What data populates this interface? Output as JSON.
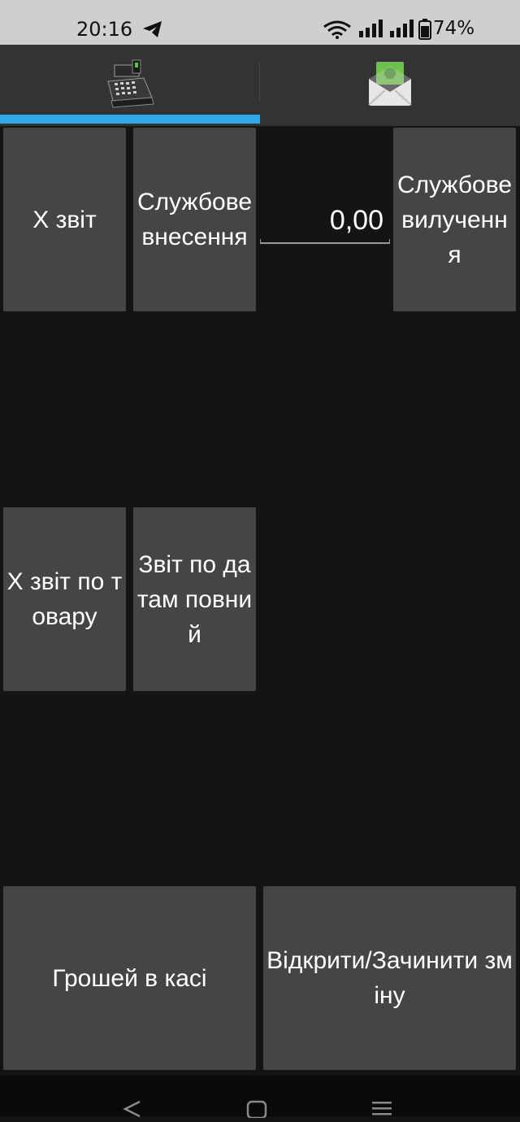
{
  "status_bar": {
    "time": "20:16",
    "battery": "74%",
    "icons": [
      "telegram-icon",
      "wifi-icon",
      "signal-icon",
      "signal-icon",
      "battery-icon"
    ]
  },
  "tabs": [
    {
      "icon": "cash-register-icon",
      "selected": true
    },
    {
      "icon": "money-envelope-icon",
      "selected": false
    }
  ],
  "colors": {
    "tab_indicator": "#2ea8e6",
    "button_bg": "#454545",
    "background": "#141414",
    "status_bar": "#cfcfcf"
  },
  "buttons": {
    "x_report": "X звіт",
    "service_deposit": "Службове внесення",
    "service_withdrawal": "Службове вилучення",
    "x_report_goods": "X звіт по товару",
    "report_by_dates": "Звіт по датам повний",
    "cash_in_register": "Грошей в касі",
    "open_close_shift": "Відкрити/Зачинити зміну"
  },
  "amount": {
    "value": "0,00"
  },
  "navigation": {
    "icons": [
      "back-icon",
      "home-icon",
      "recents-icon"
    ]
  }
}
